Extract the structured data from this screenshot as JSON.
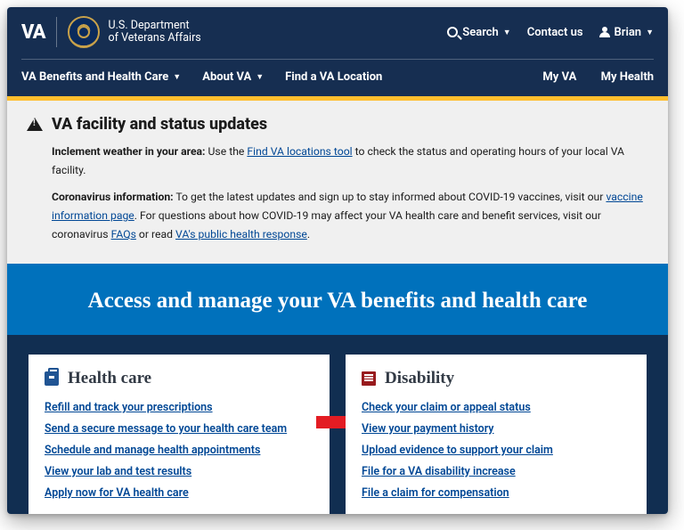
{
  "header": {
    "logo_text": "VA",
    "dept_line1": "U.S. Department",
    "dept_line2": "of Veterans Affairs",
    "search_label": "Search",
    "contact_label": "Contact us",
    "user_name": "Brian"
  },
  "nav": {
    "benefits": "VA Benefits and Health Care",
    "about": "About VA",
    "find": "Find a VA Location",
    "my_va": "My VA",
    "my_health": "My Health"
  },
  "alert": {
    "title": "VA facility and status updates",
    "weather_label": "Inclement weather in your area:",
    "weather_pre": " Use the ",
    "weather_link": "Find VA locations tool",
    "weather_post": " to check the status and operating hours of your local VA facility.",
    "covid_label": "Coronavirus information:",
    "covid_t1": " To get the latest updates and sign up to stay informed about COVID-19 vaccines, visit our ",
    "covid_link1": "vaccine information page",
    "covid_t2": ". For questions about how COVID-19 may affect your VA health care and benefit services, visit our coronavirus ",
    "covid_link2": "FAQs",
    "covid_t3": " or read ",
    "covid_link3": "VA's public health response",
    "covid_t4": "."
  },
  "hero": {
    "title": "Access and manage your VA benefits and health care"
  },
  "cards": {
    "health": {
      "title": "Health care",
      "links": [
        "Refill and track your prescriptions",
        "Send a secure message to your health care team",
        "Schedule and manage health appointments",
        "View your lab and test results",
        "Apply now for VA health care"
      ]
    },
    "disability": {
      "title": "Disability",
      "links": [
        "Check your claim or appeal status",
        "View your payment history",
        "Upload evidence to support your claim",
        "File for a VA disability increase",
        "File a claim for compensation"
      ]
    }
  }
}
